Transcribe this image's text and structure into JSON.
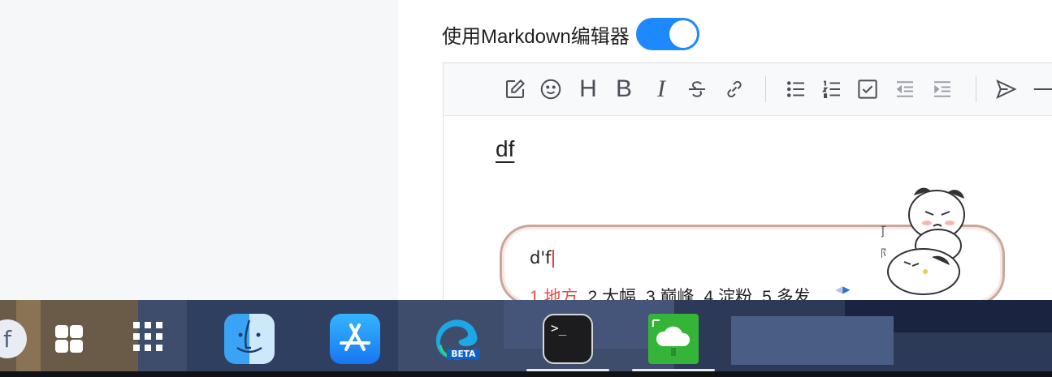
{
  "settings": {
    "markdown_toggle_label": "使用Markdown编辑器",
    "markdown_toggle_on": true
  },
  "editor": {
    "toolbar": {
      "heading_label": "H",
      "bold_label": "B",
      "italic_label": "I",
      "tools": [
        "edit-icon",
        "emoji-icon",
        "heading",
        "bold",
        "italic",
        "strikethrough-icon",
        "link-icon",
        "unordered-list-icon",
        "ordered-list-icon",
        "task-list-icon",
        "outdent-icon",
        "indent-icon",
        "send-icon",
        "horizontal-rule-icon"
      ]
    },
    "content_text": "df"
  },
  "ime": {
    "input_text": "d'f",
    "candidates": [
      "1.地方",
      "2.大幅",
      "3.巅峰",
      "4.淀粉",
      "5.多发"
    ],
    "sticker_text": [
      "打",
      "你"
    ]
  },
  "dock": {
    "apps": [
      "fedora-icon",
      "plus-grid-icon",
      "launchpad-icon",
      "finder-icon",
      "app-store-icon",
      "edge-beta-icon",
      "terminal-icon",
      "cloud-monitor-icon"
    ],
    "beta_badge": "BETA",
    "terminal_prompt": ">_"
  },
  "colors": {
    "toggle_on": "#1e88ff",
    "candidate_selected": "#e0504a",
    "ime_border": "#c8a79c"
  }
}
